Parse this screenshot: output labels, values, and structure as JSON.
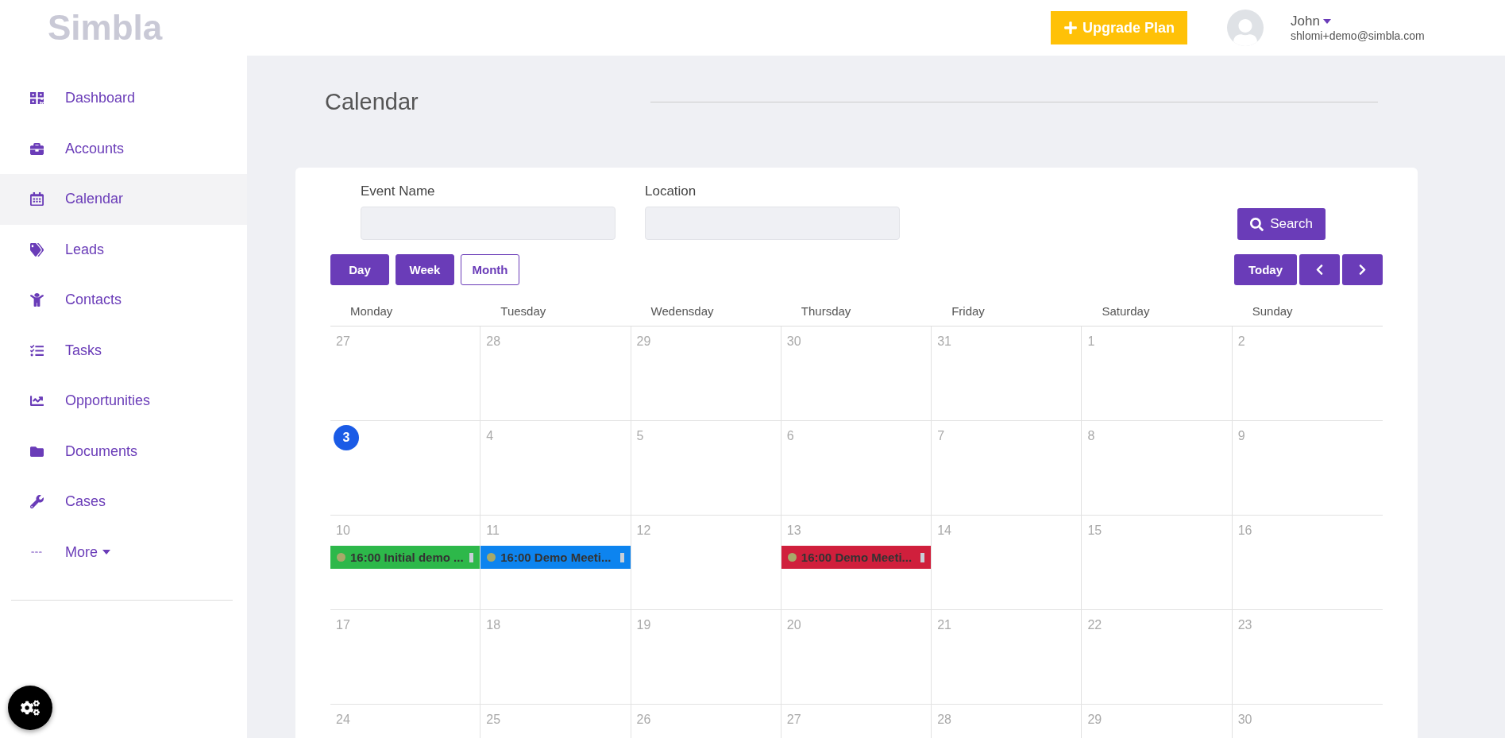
{
  "logo": "Simbla",
  "upgrade_button": "Upgrade Plan",
  "user": {
    "name": "John",
    "email": "shlomi+demo@simbla.com"
  },
  "sidebar": {
    "items": [
      {
        "label": "Dashboard",
        "kind": "link",
        "selected": false
      },
      {
        "label": "Accounts",
        "kind": "link",
        "selected": false
      },
      {
        "label": "Calendar",
        "kind": "link",
        "selected": true
      },
      {
        "label": "Leads",
        "kind": "link",
        "selected": false
      },
      {
        "label": "Contacts",
        "kind": "link",
        "selected": false
      },
      {
        "label": "Tasks",
        "kind": "link",
        "selected": false
      },
      {
        "label": "Opportunities",
        "kind": "link",
        "selected": false
      },
      {
        "label": "Documents",
        "kind": "link",
        "selected": false
      },
      {
        "label": "Cases",
        "kind": "link",
        "selected": false
      },
      {
        "label": "More",
        "kind": "dropdown",
        "selected": false
      }
    ]
  },
  "page_title": "Calendar",
  "filters": [
    {
      "label": "Event Name"
    },
    {
      "label": "Location"
    }
  ],
  "search_button": "Search",
  "views": [
    {
      "label": "Day",
      "selected": false
    },
    {
      "label": "Week",
      "selected": false
    },
    {
      "label": "Month",
      "selected": true
    }
  ],
  "today_button": "Today",
  "weekdays": [
    "Monday",
    "Tuesday",
    "Wedensday",
    "Thursday",
    "Friday",
    "Saturday",
    "Sunday"
  ],
  "weeks": [
    {
      "days": [
        {
          "day": "27",
          "today": false
        },
        {
          "day": "28",
          "today": false
        },
        {
          "day": "29",
          "today": false
        },
        {
          "day": "30",
          "today": false
        },
        {
          "day": "31",
          "today": false
        },
        {
          "day": "1",
          "today": false
        },
        {
          "day": "2",
          "today": false
        }
      ]
    },
    {
      "days": [
        {
          "day": "3",
          "today": true
        },
        {
          "day": "4",
          "today": false
        },
        {
          "day": "5",
          "today": false
        },
        {
          "day": "6",
          "today": false
        },
        {
          "day": "7",
          "today": false
        },
        {
          "day": "8",
          "today": false
        },
        {
          "day": "9",
          "today": false
        }
      ]
    },
    {
      "days": [
        {
          "day": "10",
          "today": false,
          "events": [
            {
              "time": "16:00",
              "title": "Initial demo ...",
              "color": "#2db84a"
            }
          ]
        },
        {
          "day": "11",
          "today": false,
          "events": [
            {
              "time": "16:00",
              "title": "Demo Meeti...",
              "color": "#0d84ef"
            }
          ]
        },
        {
          "day": "12",
          "today": false
        },
        {
          "day": "13",
          "today": false,
          "events": [
            {
              "time": "16:00",
              "title": "Demo Meeti...",
              "color": "#d01f3c"
            }
          ]
        },
        {
          "day": "14",
          "today": false
        },
        {
          "day": "15",
          "today": false
        },
        {
          "day": "16",
          "today": false
        }
      ]
    },
    {
      "days": [
        {
          "day": "17",
          "today": false
        },
        {
          "day": "18",
          "today": false
        },
        {
          "day": "19",
          "today": false
        },
        {
          "day": "20",
          "today": false
        },
        {
          "day": "21",
          "today": false
        },
        {
          "day": "22",
          "today": false
        },
        {
          "day": "23",
          "today": false
        }
      ]
    },
    {
      "days": [
        {
          "day": "24",
          "today": false
        },
        {
          "day": "25",
          "today": false
        },
        {
          "day": "26",
          "today": false
        },
        {
          "day": "27",
          "today": false
        },
        {
          "day": "28",
          "today": false
        },
        {
          "day": "29",
          "today": false
        },
        {
          "day": "30",
          "today": false
        }
      ]
    }
  ]
}
